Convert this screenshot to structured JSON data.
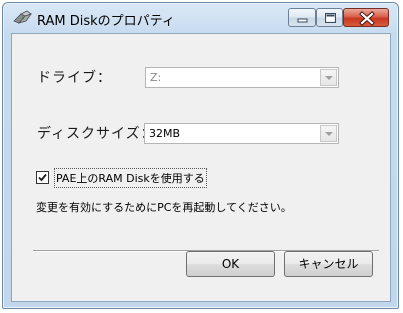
{
  "window": {
    "title": "RAM Diskのプロパティ",
    "app_icon": "ram-disk-icon",
    "caption_buttons": [
      "minimize-icon",
      "maximize-icon",
      "close-icon"
    ],
    "close_color": "#c8381f"
  },
  "form": {
    "drive_label": "ドライブ：",
    "drive_value": "Z:",
    "disk_size_label": "ディスクサイズ：",
    "disk_size_value": "32MB",
    "pae_checkbox_checked": true,
    "pae_checkbox_label": "PAE上のRAM Diskを使用する",
    "restart_note": "変更を有効にするためにPCを再起動してください。"
  },
  "buttons": {
    "ok_label": "OK",
    "cancel_label": "キャンセル"
  }
}
